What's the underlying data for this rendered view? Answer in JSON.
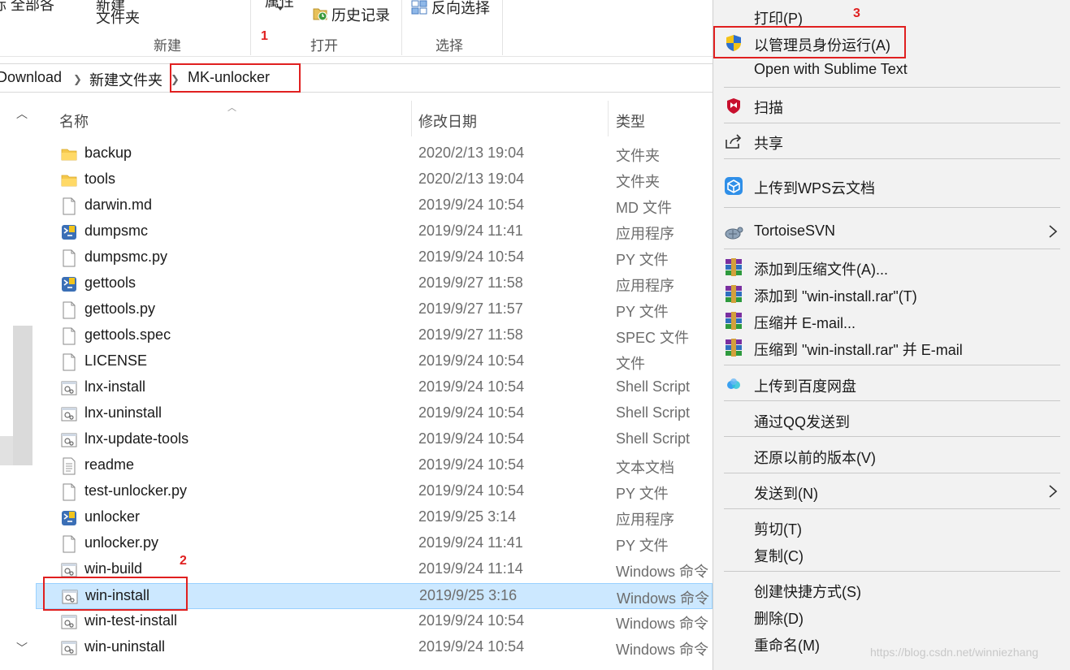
{
  "ribbon": {
    "partial_left": "际   全部各",
    "new_item_top": "新建",
    "new_item_label": "文件夹",
    "group_new": "新建",
    "prop_label": "属性",
    "history_label": "历史记录",
    "invert_label": "反向选择",
    "group_open": "打开",
    "group_select": "选择"
  },
  "address": {
    "crumbs": [
      "Download",
      "新建文件夹",
      "MK-unlocker"
    ]
  },
  "columns": {
    "name": "名称",
    "date": "修改日期",
    "type": "类型"
  },
  "files": [
    {
      "name": "backup",
      "date": "2020/2/13 19:04",
      "type": "文件夹",
      "icon": "folder-icon"
    },
    {
      "name": "tools",
      "date": "2020/2/13 19:04",
      "type": "文件夹",
      "icon": "folder-icon"
    },
    {
      "name": "darwin.md",
      "date": "2019/9/24 10:54",
      "type": "MD 文件",
      "icon": "file-icon"
    },
    {
      "name": "dumpsmc",
      "date": "2019/9/24 11:41",
      "type": "应用程序",
      "icon": "python-exe-icon"
    },
    {
      "name": "dumpsmc.py",
      "date": "2019/9/24 10:54",
      "type": "PY 文件",
      "icon": "file-icon"
    },
    {
      "name": "gettools",
      "date": "2019/9/27 11:58",
      "type": "应用程序",
      "icon": "python-exe-icon"
    },
    {
      "name": "gettools.py",
      "date": "2019/9/27 11:57",
      "type": "PY 文件",
      "icon": "file-icon"
    },
    {
      "name": "gettools.spec",
      "date": "2019/9/27 11:58",
      "type": "SPEC 文件",
      "icon": "file-icon"
    },
    {
      "name": "LICENSE",
      "date": "2019/9/24 10:54",
      "type": "文件",
      "icon": "file-icon"
    },
    {
      "name": "lnx-install",
      "date": "2019/9/24 10:54",
      "type": "Shell Script",
      "icon": "script-icon"
    },
    {
      "name": "lnx-uninstall",
      "date": "2019/9/24 10:54",
      "type": "Shell Script",
      "icon": "script-icon"
    },
    {
      "name": "lnx-update-tools",
      "date": "2019/9/24 10:54",
      "type": "Shell Script",
      "icon": "script-icon"
    },
    {
      "name": "readme",
      "date": "2019/9/24 10:54",
      "type": "文本文档",
      "icon": "text-file-icon"
    },
    {
      "name": "test-unlocker.py",
      "date": "2019/9/24 10:54",
      "type": "PY 文件",
      "icon": "file-icon"
    },
    {
      "name": "unlocker",
      "date": "2019/9/25 3:14",
      "type": "应用程序",
      "icon": "python-exe-icon"
    },
    {
      "name": "unlocker.py",
      "date": "2019/9/24 11:41",
      "type": "PY 文件",
      "icon": "file-icon"
    },
    {
      "name": "win-build",
      "date": "2019/9/24 11:14",
      "type": "Windows 命令",
      "icon": "script-icon"
    },
    {
      "name": "win-install",
      "date": "2019/9/25 3:16",
      "type": "Windows 命令",
      "icon": "script-icon",
      "selected": true
    },
    {
      "name": "win-test-install",
      "date": "2019/9/24 10:54",
      "type": "Windows 命令",
      "icon": "script-icon"
    },
    {
      "name": "win-uninstall",
      "date": "2019/9/24 10:54",
      "type": "Windows 命令",
      "icon": "script-icon"
    }
  ],
  "menu": [
    {
      "label": "打印(P)",
      "icon": "",
      "arrow": false
    },
    {
      "label": "以管理员身份运行(A)",
      "icon": "uac-shield-icon",
      "arrow": false
    },
    {
      "label": "Open with Sublime Text",
      "icon": "",
      "arrow": false
    },
    {
      "label": "扫描",
      "icon": "mcafee-icon",
      "arrow": false
    },
    {
      "label": "共享",
      "icon": "share-icon",
      "arrow": false
    },
    {
      "label": "上传到WPS云文档",
      "icon": "wps-cloud-icon",
      "arrow": false
    },
    {
      "label": "TortoiseSVN",
      "icon": "tortoisesvn-icon",
      "arrow": true
    },
    {
      "label": "添加到压缩文件(A)...",
      "icon": "winrar-icon",
      "arrow": false
    },
    {
      "label": "添加到 \"win-install.rar\"(T)",
      "icon": "winrar-icon",
      "arrow": false
    },
    {
      "label": "压缩并 E-mail...",
      "icon": "winrar-icon",
      "arrow": false
    },
    {
      "label": "压缩到 \"win-install.rar\" 并 E-mail",
      "icon": "winrar-icon",
      "arrow": false
    },
    {
      "label": "上传到百度网盘",
      "icon": "baidu-netdisk-icon",
      "arrow": false
    },
    {
      "label": "通过QQ发送到",
      "icon": "",
      "arrow": false
    },
    {
      "label": "还原以前的版本(V)",
      "icon": "",
      "arrow": false
    },
    {
      "label": "发送到(N)",
      "icon": "",
      "arrow": true
    },
    {
      "label": "剪切(T)",
      "icon": "",
      "arrow": false
    },
    {
      "label": "复制(C)",
      "icon": "",
      "arrow": false
    },
    {
      "label": "创建快捷方式(S)",
      "icon": "",
      "arrow": false
    },
    {
      "label": "删除(D)",
      "icon": "",
      "arrow": false
    },
    {
      "label": "重命名(M)",
      "icon": "",
      "arrow": false
    }
  ],
  "annotations": [
    "1",
    "2",
    "3"
  ],
  "watermark": "https://blog.csdn.net/winniezhang",
  "colors": {
    "selection": "#cce8ff",
    "annotation_red": "#e02020",
    "menu_bg": "#f2f2f2"
  }
}
